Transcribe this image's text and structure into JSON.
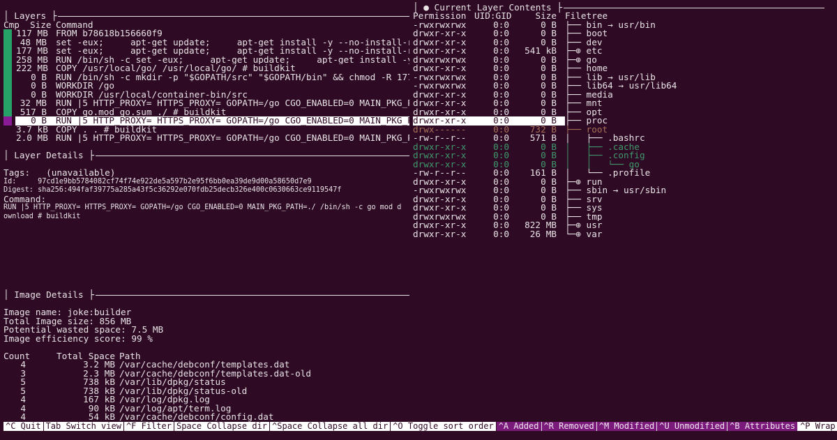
{
  "colors": {
    "background": "#2f0a24",
    "added": "#3e9a6c",
    "modified": "#a8715a",
    "bar_green": "#26a269",
    "bar_purple": "#8b1a96",
    "footer_active": "#7a1b7c"
  },
  "layers": {
    "title": "Layers",
    "headers": {
      "cmp": "Cmp",
      "size": "Size",
      "command": "Command"
    },
    "selected_index": 10,
    "rows": [
      {
        "size": "117 MB",
        "command": "FROM b78618b156660f9",
        "bar": "green"
      },
      {
        "size": "48 MB",
        "command": "set -eux;     apt-get update;     apt-get install -y --no-install-recommends",
        "bar": "green"
      },
      {
        "size": "177 MB",
        "command": "set -eux;     apt-get update;     apt-get install -y --no-install-recommends",
        "bar": "green"
      },
      {
        "size": "258 MB",
        "command": "RUN /bin/sh -c set -eux;     apt-get update;     apt-get install -y --no-install-",
        "bar": "green"
      },
      {
        "size": "222 MB",
        "command": "COPY /usr/local/go/ /usr/local/go/ # buildkit",
        "bar": "green"
      },
      {
        "size": "0 B",
        "command": "RUN /bin/sh -c mkdir -p \"$GOPATH/src\" \"$GOPATH/bin\" && chmod -R 1777 \"$GOPATH\" #",
        "bar": "green"
      },
      {
        "size": "0 B",
        "command": "WORKDIR /go",
        "bar": "green"
      },
      {
        "size": "0 B",
        "command": "WORKDIR /usr/local/container-bin/src",
        "bar": "green"
      },
      {
        "size": "32 MB",
        "command": "RUN |5 HTTP_PROXY= HTTPS_PROXY= GOPATH=/go CGO_ENABLED=0 MAIN_PKG_PATH=./ /bin/sh",
        "bar": "green"
      },
      {
        "size": "517 B",
        "command": "COPY go.mod go.sum ./ # buildkit",
        "bar": "green"
      },
      {
        "size": "0 B",
        "command": "RUN |5 HTTP_PROXY= HTTPS_PROXY= GOPATH=/go CGO_ENABLED=0 MAIN_PKG_PATH=./ /bin/sh",
        "bar": "purple"
      },
      {
        "size": "3.7 kB",
        "command": "COPY . . # buildkit",
        "bar": ""
      },
      {
        "size": "2.0 MB",
        "command": "RUN |5 HTTP_PROXY= HTTPS_PROXY= GOPATH=/go CGO_ENABLED=0 MAIN_PKG_PATH=./ /bin/sh",
        "bar": ""
      }
    ]
  },
  "layer_details": {
    "title": "Layer Details",
    "tags_label": "Tags:   ",
    "tags": "(unavailable)",
    "id_label": "Id:     ",
    "id": "97cd1e9bb5784082cf74f74e922de5a597b2e95f6bb0ea39de9d00a58650d7e9",
    "digest_label": "Digest: ",
    "digest": "sha256:494faf39775a285a43f5c36292e070fdb25decb326e400c0630663ce9119547f",
    "command_label": "Command:",
    "command_line1": "RUN |5 HTTP_PROXY= HTTPS_PROXY= GOPATH=/go CGO_ENABLED=0 MAIN_PKG_PATH=./ /bin/sh -c go mod d",
    "command_line2": "ownload # buildkit"
  },
  "image_details": {
    "title": "Image Details",
    "image_name": "Image name: joke:builder",
    "total_size": "Total Image size: 856 MB",
    "wasted": "Potential wasted space: 7.5 MB",
    "efficiency": "Image efficiency score: 99 %",
    "headers": {
      "count": "Count",
      "space": "Total Space",
      "path": "Path"
    },
    "rows": [
      {
        "count": "4",
        "space": "3.2 MB",
        "path": "/var/cache/debconf/templates.dat"
      },
      {
        "count": "3",
        "space": "2.3 MB",
        "path": "/var/cache/debconf/templates.dat-old"
      },
      {
        "count": "5",
        "space": "738 kB",
        "path": "/var/lib/dpkg/status"
      },
      {
        "count": "5",
        "space": "738 kB",
        "path": "/var/lib/dpkg/status-old"
      },
      {
        "count": "4",
        "space": "167 kB",
        "path": "/var/log/dpkg.log"
      },
      {
        "count": "4",
        "space": "90 kB",
        "path": "/var/log/apt/term.log"
      },
      {
        "count": "4",
        "space": "54 kB",
        "path": "/var/cache/debconf/config.dat"
      }
    ]
  },
  "contents": {
    "title": "● Current Layer Contents",
    "headers": {
      "permission": "Permission",
      "uid": "UID:GID",
      "size": "Size",
      "tree": "Filetree"
    },
    "selected_index": 10,
    "rows": [
      {
        "perm": "-rwxrwxrwx",
        "uid": "0:0",
        "size": "0 B",
        "tree": "├── bin → usr/bin",
        "state": ""
      },
      {
        "perm": "drwxr-xr-x",
        "uid": "0:0",
        "size": "0 B",
        "tree": "├── boot",
        "state": ""
      },
      {
        "perm": "drwxr-xr-x",
        "uid": "0:0",
        "size": "0 B",
        "tree": "├── dev",
        "state": ""
      },
      {
        "perm": "drwxr-xr-x",
        "uid": "0:0",
        "size": "541 kB",
        "tree": "├─⊕ etc",
        "state": ""
      },
      {
        "perm": "drwxrwxrwx",
        "uid": "0:0",
        "size": "0 B",
        "tree": "├─⊕ go",
        "state": ""
      },
      {
        "perm": "drwxr-xr-x",
        "uid": "0:0",
        "size": "0 B",
        "tree": "├── home",
        "state": ""
      },
      {
        "perm": "-rwxrwxrwx",
        "uid": "0:0",
        "size": "0 B",
        "tree": "├── lib → usr/lib",
        "state": ""
      },
      {
        "perm": "-rwxrwxrwx",
        "uid": "0:0",
        "size": "0 B",
        "tree": "├── lib64 → usr/lib64",
        "state": ""
      },
      {
        "perm": "drwxr-xr-x",
        "uid": "0:0",
        "size": "0 B",
        "tree": "├── media",
        "state": ""
      },
      {
        "perm": "drwxr-xr-x",
        "uid": "0:0",
        "size": "0 B",
        "tree": "├── mnt",
        "state": ""
      },
      {
        "perm": "drwxr-xr-x",
        "uid": "0:0",
        "size": "0 B",
        "tree": "├── opt",
        "state": ""
      },
      {
        "perm": "drwxr-xr-x",
        "uid": "0:0",
        "size": "0 B",
        "tree": "├── proc",
        "state": "selected"
      },
      {
        "perm": "drwx------",
        "uid": "0:0",
        "size": "732 B",
        "tree": "├── root",
        "state": "modified"
      },
      {
        "perm": "-rw-r--r--",
        "uid": "0:0",
        "size": "571 B",
        "tree": "│   ├── .bashrc",
        "state": ""
      },
      {
        "perm": "drwxr-xr-x",
        "uid": "0:0",
        "size": "0 B",
        "tree": "│   ├── .cache",
        "state": "added"
      },
      {
        "perm": "drwxr-xr-x",
        "uid": "0:0",
        "size": "0 B",
        "tree": "│   ├── .config",
        "state": "added"
      },
      {
        "perm": "drwxr-xr-x",
        "uid": "0:0",
        "size": "0 B",
        "tree": "│   │   └── go",
        "state": "added"
      },
      {
        "perm": "-rw-r--r--",
        "uid": "0:0",
        "size": "161 B",
        "tree": "│   └── .profile",
        "state": ""
      },
      {
        "perm": "drwxr-xr-x",
        "uid": "0:0",
        "size": "0 B",
        "tree": "├─⊕ run",
        "state": ""
      },
      {
        "perm": "-rwxrwxrwx",
        "uid": "0:0",
        "size": "0 B",
        "tree": "├── sbin → usr/sbin",
        "state": ""
      },
      {
        "perm": "drwxr-xr-x",
        "uid": "0:0",
        "size": "0 B",
        "tree": "├── srv",
        "state": ""
      },
      {
        "perm": "drwxr-xr-x",
        "uid": "0:0",
        "size": "0 B",
        "tree": "├── sys",
        "state": ""
      },
      {
        "perm": "drwxrwxrwx",
        "uid": "0:0",
        "size": "0 B",
        "tree": "├── tmp",
        "state": ""
      },
      {
        "perm": "drwxr-xr-x",
        "uid": "0:0",
        "size": "822 MB",
        "tree": "├─⊕ usr",
        "state": ""
      },
      {
        "perm": "drwxr-xr-x",
        "uid": "0:0",
        "size": "26 MB",
        "tree": "└─⊕ var",
        "state": ""
      }
    ]
  },
  "footer": [
    {
      "label": "^C Quit",
      "active": false
    },
    {
      "label": "Tab Switch view",
      "active": false
    },
    {
      "label": "^F Filter",
      "active": false
    },
    {
      "label": "Space Collapse dir",
      "active": false
    },
    {
      "label": "^Space Collapse all dir",
      "active": false
    },
    {
      "label": "^O Toggle sort order",
      "active": false
    },
    {
      "label": "^A Added",
      "active": true
    },
    {
      "label": "^R Removed",
      "active": true
    },
    {
      "label": "^M Modified",
      "active": true
    },
    {
      "label": "^U Unmodified",
      "active": true
    },
    {
      "label": "^B Attributes",
      "active": true
    },
    {
      "label": "^P Wrap",
      "active": false
    }
  ]
}
